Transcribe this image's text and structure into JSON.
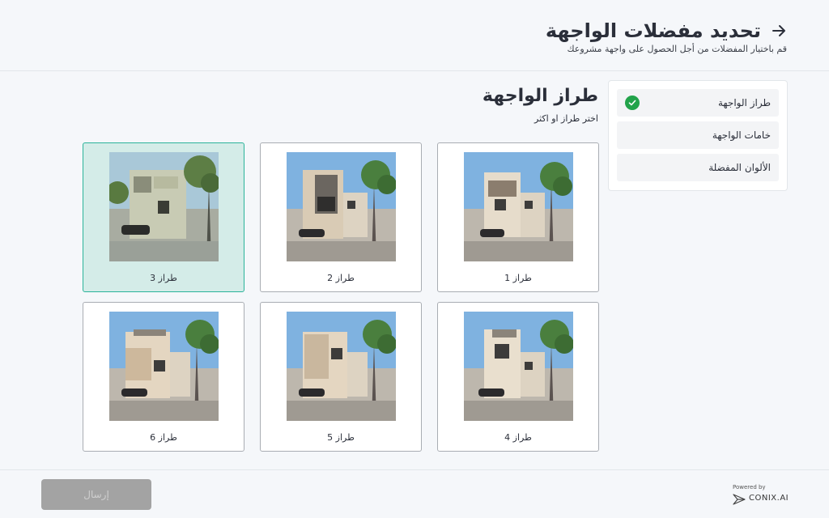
{
  "header": {
    "title": "تحديد مفضلات الواجهة",
    "subtitle": "قم باختيار المفضلات من أجل الحصول على واجهة مشروعك"
  },
  "sidebar": {
    "items": [
      {
        "label": "طراز الواجهة",
        "completed": true
      },
      {
        "label": "خامات الواجهة",
        "completed": false
      },
      {
        "label": "الألوان المفضلة",
        "completed": false
      }
    ]
  },
  "section": {
    "title": "طراز الواجهة",
    "subtitle": "اختر طراز او اكثر"
  },
  "styles": [
    {
      "label": "طراز 1",
      "selected": false
    },
    {
      "label": "طراز 2",
      "selected": false
    },
    {
      "label": "طراز 3",
      "selected": true
    },
    {
      "label": "طراز 4",
      "selected": false
    },
    {
      "label": "طراز 5",
      "selected": false
    },
    {
      "label": "طراز 6",
      "selected": false
    }
  ],
  "footer": {
    "submit_label": "إرسال",
    "powered_by": "Powered by",
    "brand": "CONIX.AI"
  },
  "colors": {
    "selected_border": "#2bb39a",
    "selected_bg": "#d4ece8",
    "check_green": "#22a34a",
    "disabled_button": "#a3a3a3"
  }
}
